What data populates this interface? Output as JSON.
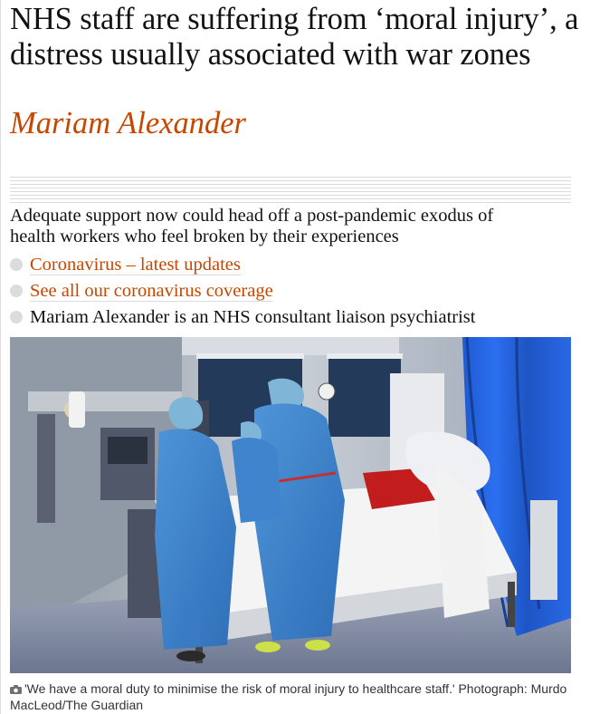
{
  "article": {
    "headline": "NHS staff are suffering from ‘moral injury’, a distress usually associated with war zones",
    "byline": "Mariam Alexander",
    "standfirst": "Adequate support now could head off a post-pandemic exodus of health workers who feel broken by their experiences",
    "bullets": [
      {
        "text": "Coronavirus – latest updates",
        "is_link": true
      },
      {
        "text": "See all our coronavirus coverage",
        "is_link": true
      },
      {
        "text": "Mariam Alexander is an NHS consultant liaison psychiatrist",
        "is_link": false
      }
    ],
    "image": {
      "caption": "'We have a moral duty to minimise the risk of moral injury to healthcare staff.' Photograph: Murdo MacLeod/The Guardian"
    }
  },
  "colors": {
    "accent": "#c74600",
    "text": "#121212",
    "rule": "#dcdcdc",
    "caption": "#333333"
  },
  "icons": {
    "caption_icon": "camera-icon",
    "bullet_icon": "grey-circle"
  }
}
